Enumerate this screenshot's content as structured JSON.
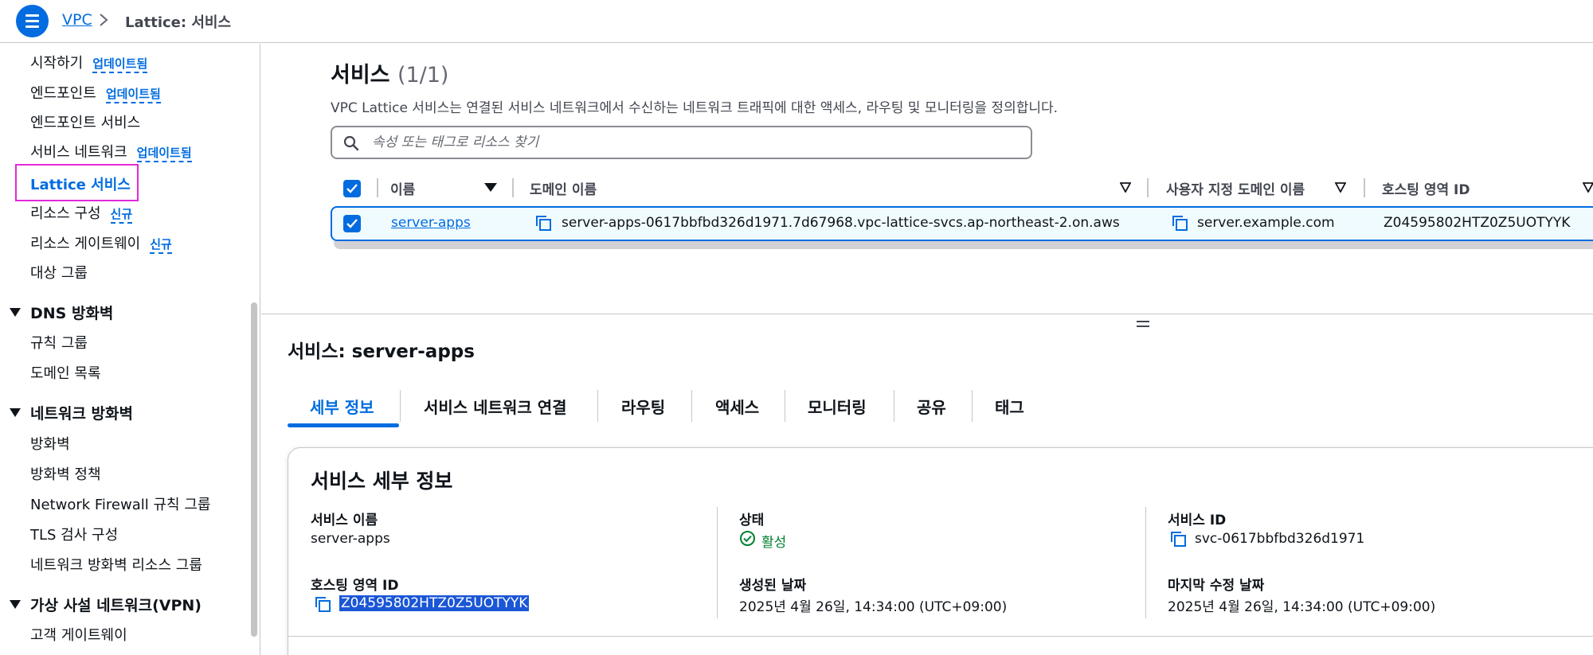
{
  "breadcrumb": {
    "root": "VPC",
    "current": "Lattice: 서비스"
  },
  "sidebar": {
    "items": [
      {
        "label": "시작하기",
        "badge": "업데이트됨"
      },
      {
        "label": "엔드포인트",
        "badge": "업데이트됨"
      },
      {
        "label": "엔드포인트 서비스",
        "badge": ""
      },
      {
        "label": "서비스 네트워크",
        "badge": "업데이트됨"
      },
      {
        "label": "Lattice 서비스",
        "badge": "",
        "active": true
      },
      {
        "label": "리소스 구성",
        "badge": "신규"
      },
      {
        "label": "리소스 게이트웨이",
        "badge": "신규"
      },
      {
        "label": "대상 그룹",
        "badge": ""
      }
    ],
    "dns_firewall": {
      "title": "DNS 방화벽",
      "items": [
        "규칙 그룹",
        "도메인 목록"
      ]
    },
    "network_firewall": {
      "title": "네트워크 방화벽",
      "items": [
        "방화벽",
        "방화벽 정책",
        "Network Firewall 규칙 그룹",
        "TLS 검사 구성",
        "네트워크 방화벽 리소스 그룹"
      ]
    },
    "vpn": {
      "title": "가상 사설 네트워크(VPN)",
      "items": [
        "고객 게이트웨이"
      ]
    }
  },
  "services": {
    "title": "서비스",
    "count": "(1/1)",
    "description": "VPC Lattice 서비스는 연결된 서비스 네트워크에서 수신하는 네트워크 트래픽에 대한 액세스, 라우팅 및 모니터링을 정의합니다.",
    "search_placeholder": "속성 또는 태그로 리소스 찾기",
    "columns": [
      "이름",
      "도메인 이름",
      "사용자 지정 도메인 이름",
      "호스팅 영역 ID"
    ],
    "rows": [
      {
        "name": "server-apps",
        "domain": "server-apps-0617bbfbd326d1971.7d67968.vpc-lattice-svcs.ap-northeast-2.on.aws",
        "custom_domain": "server.example.com",
        "hosted_zone": "Z04595802HTZ0Z5UOTYYK"
      }
    ]
  },
  "detail": {
    "title": "서비스: server-apps",
    "tabs": [
      "세부 정보",
      "서비스 네트워크 연결",
      "라우팅",
      "액세스",
      "모니터링",
      "공유",
      "태그"
    ],
    "card_title": "서비스 세부 정보",
    "fields": {
      "service_name_label": "서비스 이름",
      "service_name": "server-apps",
      "hosted_zone_label": "호스팅 영역 ID",
      "hosted_zone": "Z04595802HTZ0Z5UOTYYK",
      "status_label": "상태",
      "status": "활성",
      "created_label": "생성된 날짜",
      "created": "2025년 4월 26일, 14:34:00 (UTC+09:00)",
      "service_id_label": "서비스 ID",
      "service_id": "svc-0617bbfbd326d1971",
      "modified_label": "마지막 수정 날짜",
      "modified": "2025년 4월 26일, 14:34:00 (UTC+09:00)"
    }
  },
  "colors": {
    "accent": "#006ce0",
    "success": "#00802f",
    "highlight": "#e32ad8"
  }
}
